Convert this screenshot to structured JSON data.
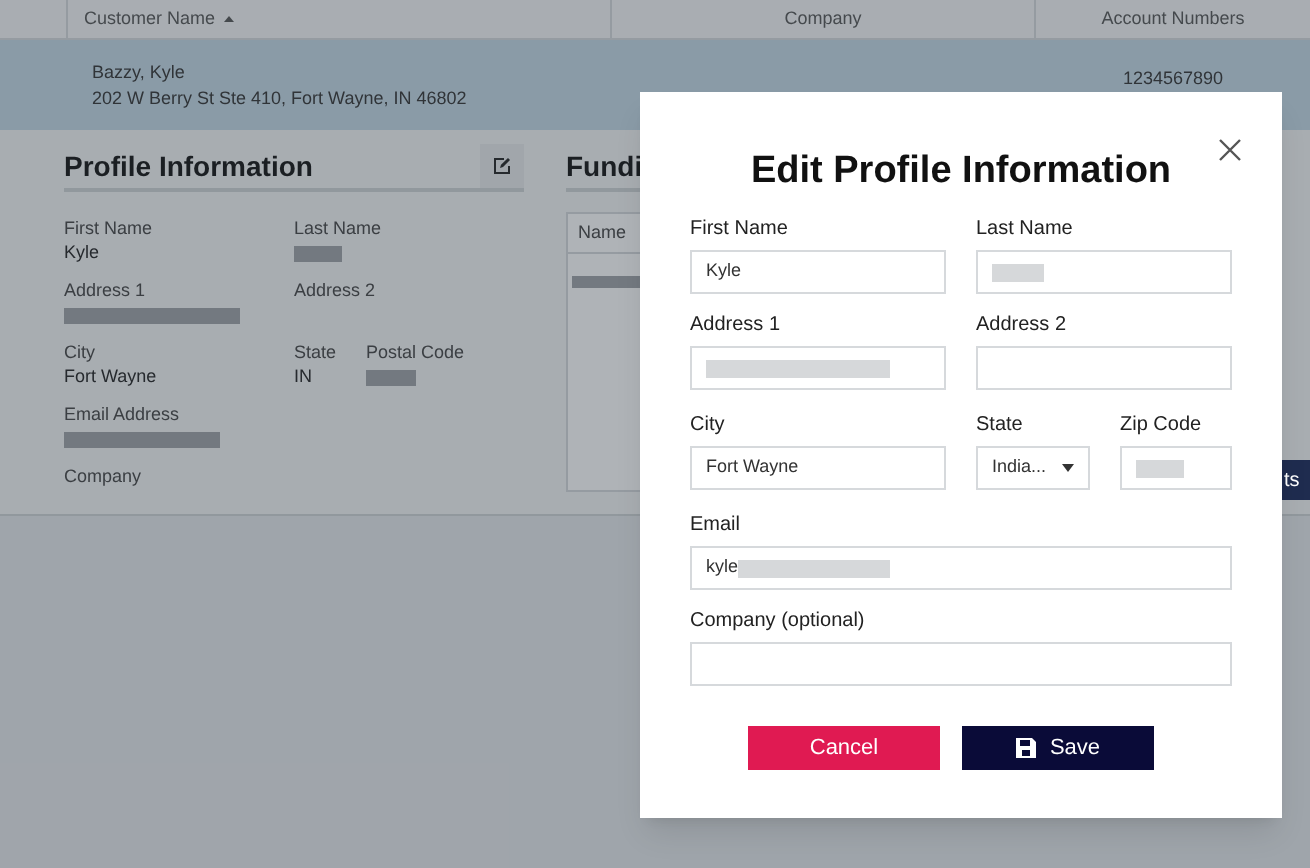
{
  "table": {
    "columns": [
      {
        "label": "Customer Name",
        "sort_ascending": true
      },
      {
        "label": "Company"
      },
      {
        "label": "Account Numbers"
      }
    ],
    "row": {
      "name": "Bazzy, Kyle",
      "address": "202 W Berry St Ste 410, Fort Wayne, IN 46802",
      "account": "1234567890",
      "selected": true
    }
  },
  "profile": {
    "title": "Profile Information",
    "fields": [
      {
        "label": "First Name",
        "value": "Kyle",
        "blurred": false
      },
      {
        "label": "Last Name",
        "blurred": true
      },
      {
        "label": "Address 1",
        "blurred": true
      },
      {
        "label": "Address 2",
        "blurred": false
      },
      {
        "label": "City",
        "value": "Fort Wayne",
        "blurred": false
      },
      {
        "label": "State",
        "value": "IN",
        "blurred": false
      },
      {
        "label": "Postal Code",
        "blurred": true
      },
      {
        "label": "Email Address",
        "blurred": true
      },
      {
        "label": "Company",
        "blurred": false
      }
    ]
  },
  "funding": {
    "title": "Fundi",
    "column": "Name",
    "row_blurred": true
  },
  "side_button": {
    "label": "ts"
  },
  "dialog": {
    "title": "Edit Profile Information",
    "fields": [
      {
        "kind": "text",
        "label": "First Name",
        "value": "Kyle",
        "blurred": false
      },
      {
        "kind": "text",
        "label": "Last Name",
        "blurred": true
      },
      {
        "kind": "text",
        "label": "Address 1",
        "blurred": true
      },
      {
        "kind": "text",
        "label": "Address 2",
        "blurred": false
      },
      {
        "kind": "text",
        "label": "City",
        "value": "Fort Wayne",
        "blurred": false
      },
      {
        "kind": "select",
        "label": "State",
        "value": "India..."
      },
      {
        "kind": "text",
        "label": "Zip Code",
        "blurred": true
      },
      {
        "kind": "text",
        "label": "Email",
        "value": "kyle",
        "blurred": true
      },
      {
        "kind": "text",
        "label": "Company (optional)",
        "blurred": false
      }
    ],
    "buttons": [
      {
        "kind": "cancel",
        "label": "Cancel"
      },
      {
        "kind": "save",
        "label": "Save"
      }
    ]
  }
}
